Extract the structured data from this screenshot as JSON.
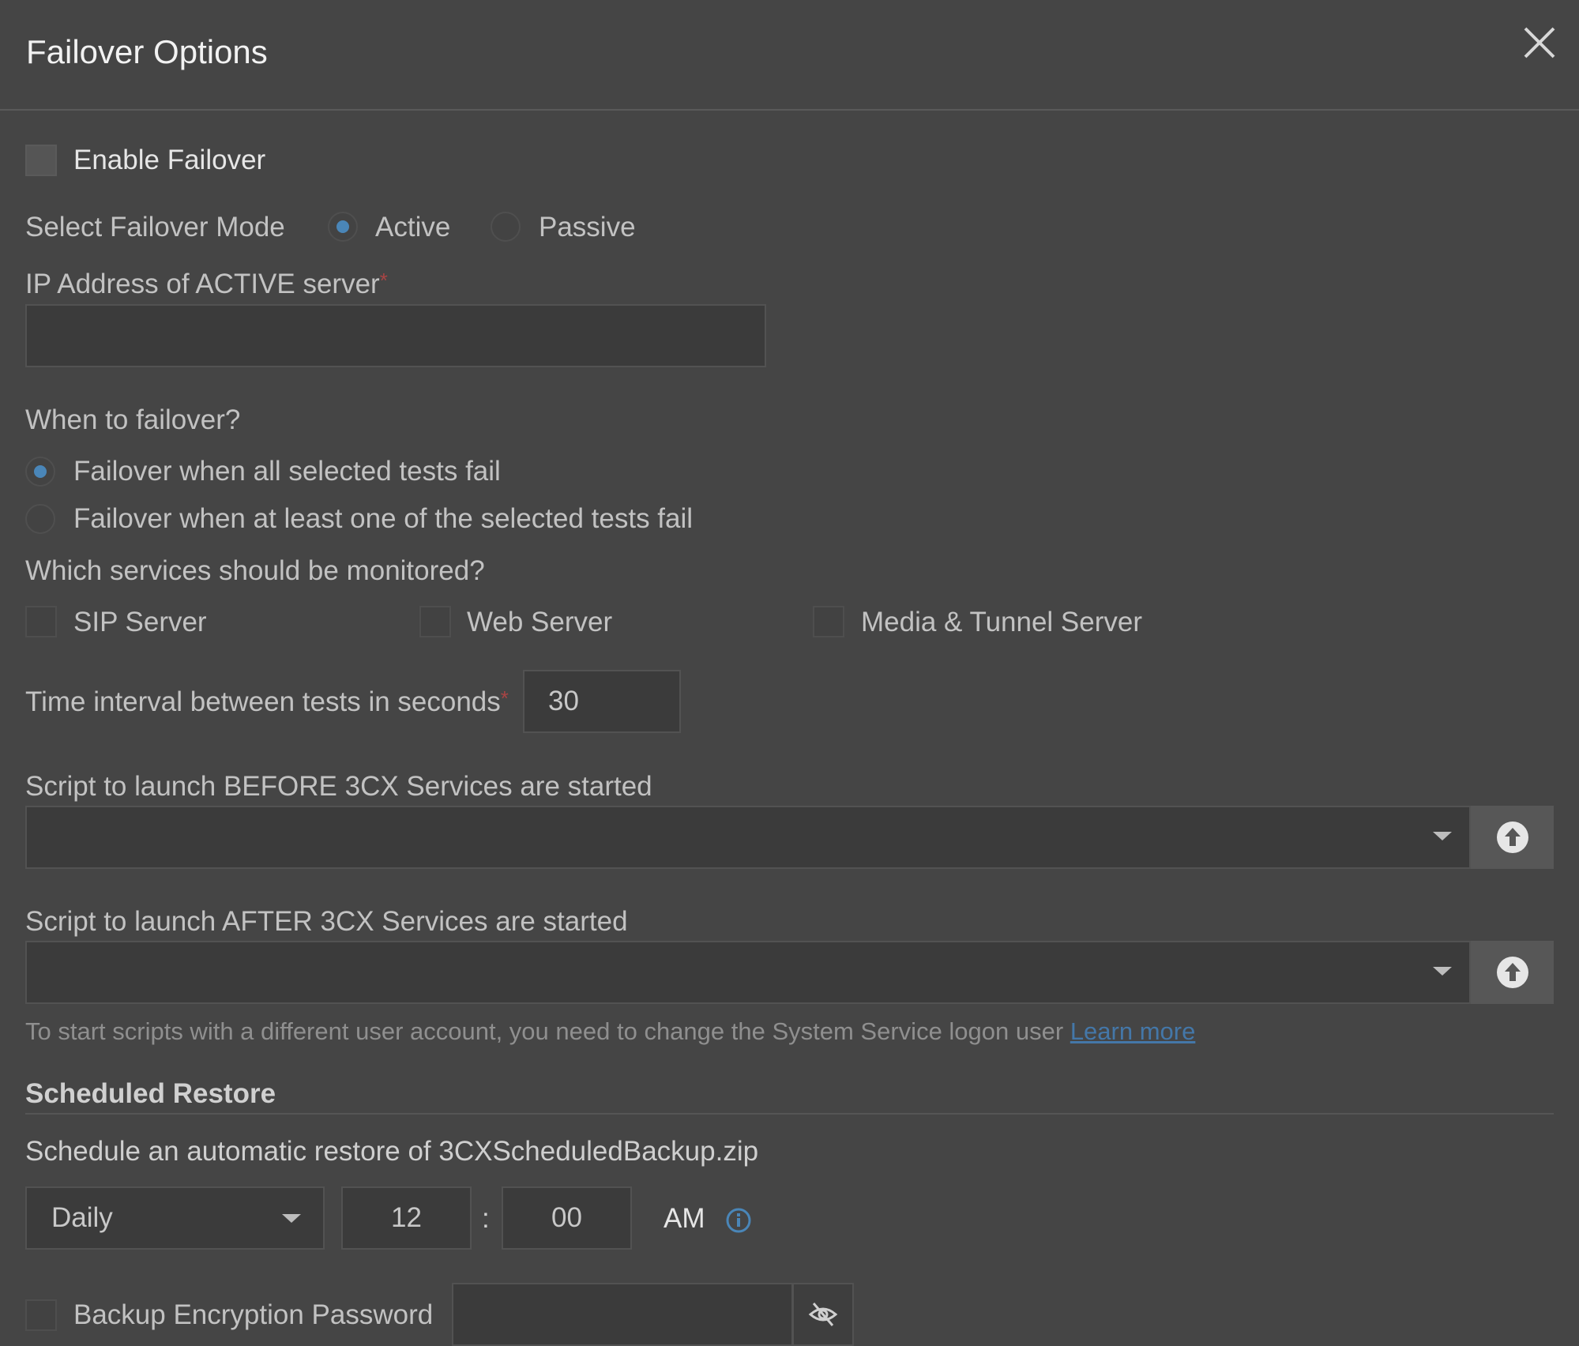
{
  "dialog": {
    "title": "Failover Options"
  },
  "enable_failover": {
    "label": "Enable Failover",
    "checked": false
  },
  "failover_mode": {
    "label": "Select Failover Mode",
    "options": [
      "Active",
      "Passive"
    ],
    "selected": "Active"
  },
  "active_ip": {
    "label": "IP Address of ACTIVE server",
    "required_mark": "*",
    "value": ""
  },
  "when_to_failover": {
    "label": "When to failover?",
    "options": [
      "Failover when all selected tests fail",
      "Failover when at least one of the selected tests fail"
    ],
    "selected": "Failover when all selected tests fail"
  },
  "services": {
    "label": "Which services should be monitored?",
    "items": [
      "SIP Server",
      "Web Server",
      "Media & Tunnel Server"
    ]
  },
  "interval": {
    "label": "Time interval between tests in seconds",
    "required_mark": "*",
    "value": "30"
  },
  "script_before": {
    "label": "Script to launch BEFORE 3CX Services are started",
    "value": ""
  },
  "script_after": {
    "label": "Script to launch AFTER 3CX Services are started",
    "value": ""
  },
  "script_note": {
    "text": "To start scripts with a different user account, you need to change the System Service logon user",
    "link": "Learn more"
  },
  "scheduled_restore": {
    "heading": "Scheduled Restore",
    "description": "Schedule an automatic restore of 3CXScheduledBackup.zip",
    "frequency": "Daily",
    "hour": "12",
    "separator": ":",
    "minute": "00",
    "ampm": "AM"
  },
  "backup_password": {
    "label": "Backup Encryption Password",
    "value": ""
  },
  "colors": {
    "background": "#454545",
    "accent": "#4a86b8",
    "link": "#4477a8",
    "required": "#a84444"
  },
  "icons": [
    "close-icon",
    "chevron-down-icon",
    "upload-icon",
    "info-icon",
    "eye-off-icon"
  ]
}
